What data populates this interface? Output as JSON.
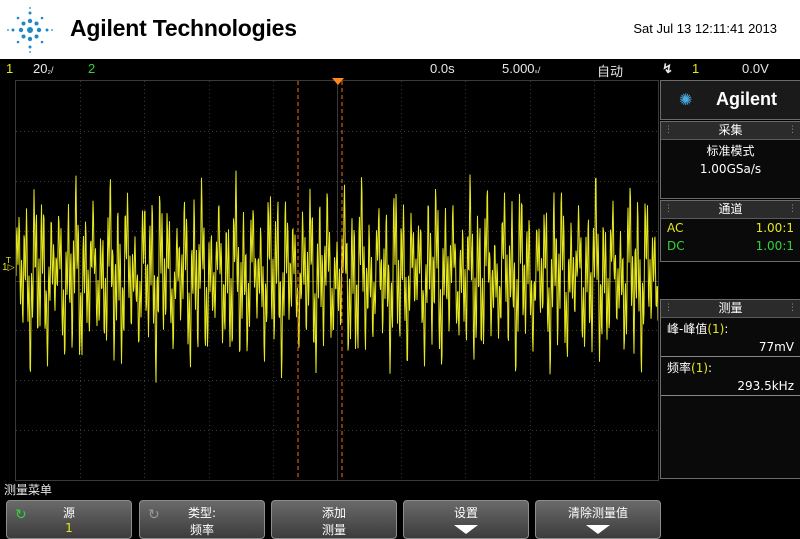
{
  "header": {
    "brand": "Agilent Technologies",
    "datetime": "Sat Jul 13 12:11:41 2013"
  },
  "status_bar": {
    "ch1_num": "1",
    "ch1_scale": "20",
    "ch1_scale_unit_icon": "v-per-div",
    "ch2_num": "2",
    "time_offset": "0.0s",
    "time_scale": "5.000",
    "time_scale_unit_icon": "s-per-div",
    "trigger_mode": "自动",
    "trigger_edge_icon": "rising-edge-icon",
    "trigger_source": "1",
    "trigger_level": "0.0V"
  },
  "side_panel": {
    "logo_text": "Agilent",
    "acquire": {
      "title": "采集",
      "mode": "标准模式",
      "rate": "1.00GSa/s"
    },
    "channels": {
      "title": "通道",
      "rows": [
        {
          "coupling": "AC",
          "probe": "1.00:1",
          "color": "#e7e71e"
        },
        {
          "coupling": "DC",
          "probe": "1.00:1",
          "color": "#35d13b"
        }
      ]
    },
    "measure": {
      "title": "测量",
      "items": [
        {
          "label_main": "峰-峰值",
          "label_src": "(1)",
          "label_colon": ":",
          "value": "77mV"
        },
        {
          "label_main": "频率",
          "label_src": "(1)",
          "label_colon": ":",
          "value": "293.5kHz"
        }
      ]
    }
  },
  "screen": {
    "ch1_marker": "1",
    "trigger_marker": "T",
    "colors": {
      "ch1": "#e7e71e",
      "ch2": "#35d13b",
      "cursor": "#ff6a1a",
      "grid": "#3a3a3a"
    }
  },
  "menu": {
    "label": "测量菜单",
    "softkeys": [
      {
        "line1": "源",
        "line2": "1",
        "icon": "cycle-icon"
      },
      {
        "line1": "类型:",
        "line2": "频率",
        "icon": "cycle-icon"
      },
      {
        "line1": "添加",
        "line2": "测量"
      },
      {
        "line1": "设置",
        "line2": "",
        "icon": "arrow-down-icon"
      },
      {
        "line1": "清除测量值",
        "line2": "",
        "icon": "arrow-down-icon"
      }
    ]
  }
}
